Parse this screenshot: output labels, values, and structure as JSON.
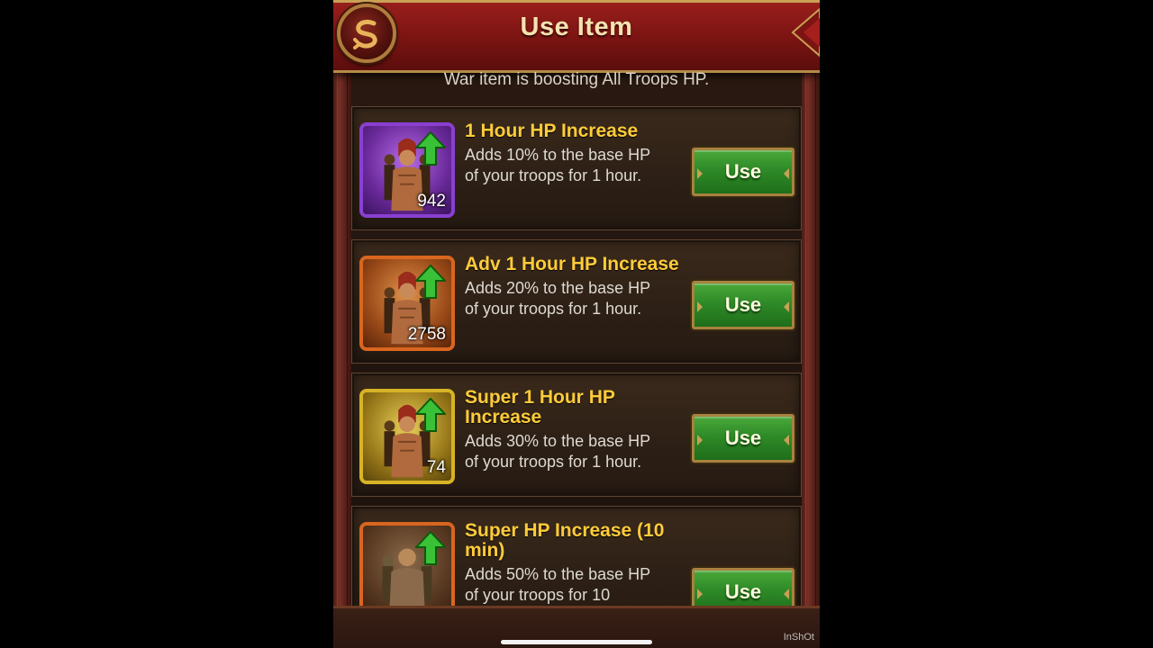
{
  "header": {
    "title": "Use Item",
    "back_icon": "back-swirl-icon"
  },
  "subtitle": "War item is boosting All Troops HP.",
  "items": [
    {
      "name": "1 Hour HP Increase",
      "desc_line1": "Adds 10% to the base HP",
      "desc_line2": "of your troops for 1 hour.",
      "count": "942",
      "button": "Use",
      "frame_color": "#8a3fd1"
    },
    {
      "name": "Adv 1 Hour HP Increase",
      "desc_line1": "Adds 20% to the base HP",
      "desc_line2": "of your troops for 1 hour.",
      "count": "2758",
      "button": "Use",
      "frame_color": "#d8661f"
    },
    {
      "name": "Super 1 Hour HP Increase",
      "desc_line1": "Adds 30% to the base HP",
      "desc_line2": "of your troops for 1 hour.",
      "count": "74",
      "button": "Use",
      "frame_color": "#d7b326"
    },
    {
      "name": "Super HP Increase (10 min)",
      "desc_line1": "Adds 50% to the base HP",
      "desc_line2": "of your troops for 10",
      "count": "",
      "button": "Use",
      "frame_color": "#d8661f"
    }
  ],
  "watermark": "InShOt"
}
